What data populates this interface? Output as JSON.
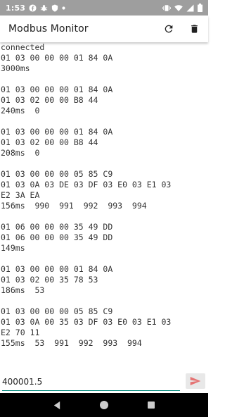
{
  "status_bar": {
    "time": "1:53"
  },
  "app_bar": {
    "title": "Modbus Monitor"
  },
  "log": {
    "lines": [
      "connected",
      "01 03 00 00 00 01 84 0A",
      "3000ms",
      "",
      "01 03 00 00 00 01 84 0A",
      "01 03 02 00 00 B8 44",
      "240ms  0",
      "",
      "01 03 00 00 00 01 84 0A",
      "01 03 02 00 00 B8 44",
      "208ms  0",
      "",
      "01 03 00 00 00 05 85 C9",
      "01 03 0A 03 DE 03 DF 03 E0 03 E1 03",
      "E2 3A EA",
      "156ms  990  991  992  993  994",
      "",
      "01 06 00 00 00 35 49 DD",
      "01 06 00 00 00 35 49 DD",
      "149ms",
      "",
      "01 03 00 00 00 01 84 0A",
      "01 03 02 00 35 78 53",
      "186ms  53",
      "",
      "01 03 00 00 00 05 85 C9",
      "01 03 0A 00 35 03 DF 03 E0 03 E1 03",
      "E2 70 11",
      "155ms  53  991  992  993  994"
    ]
  },
  "input": {
    "value": "400001.5"
  },
  "colors": {
    "accent": "#00897b",
    "send_icon": "#e57373",
    "status_bar": "#9e9e9e"
  },
  "icons": {
    "refresh": "refresh-icon",
    "delete": "delete-icon",
    "send": "send-icon"
  }
}
